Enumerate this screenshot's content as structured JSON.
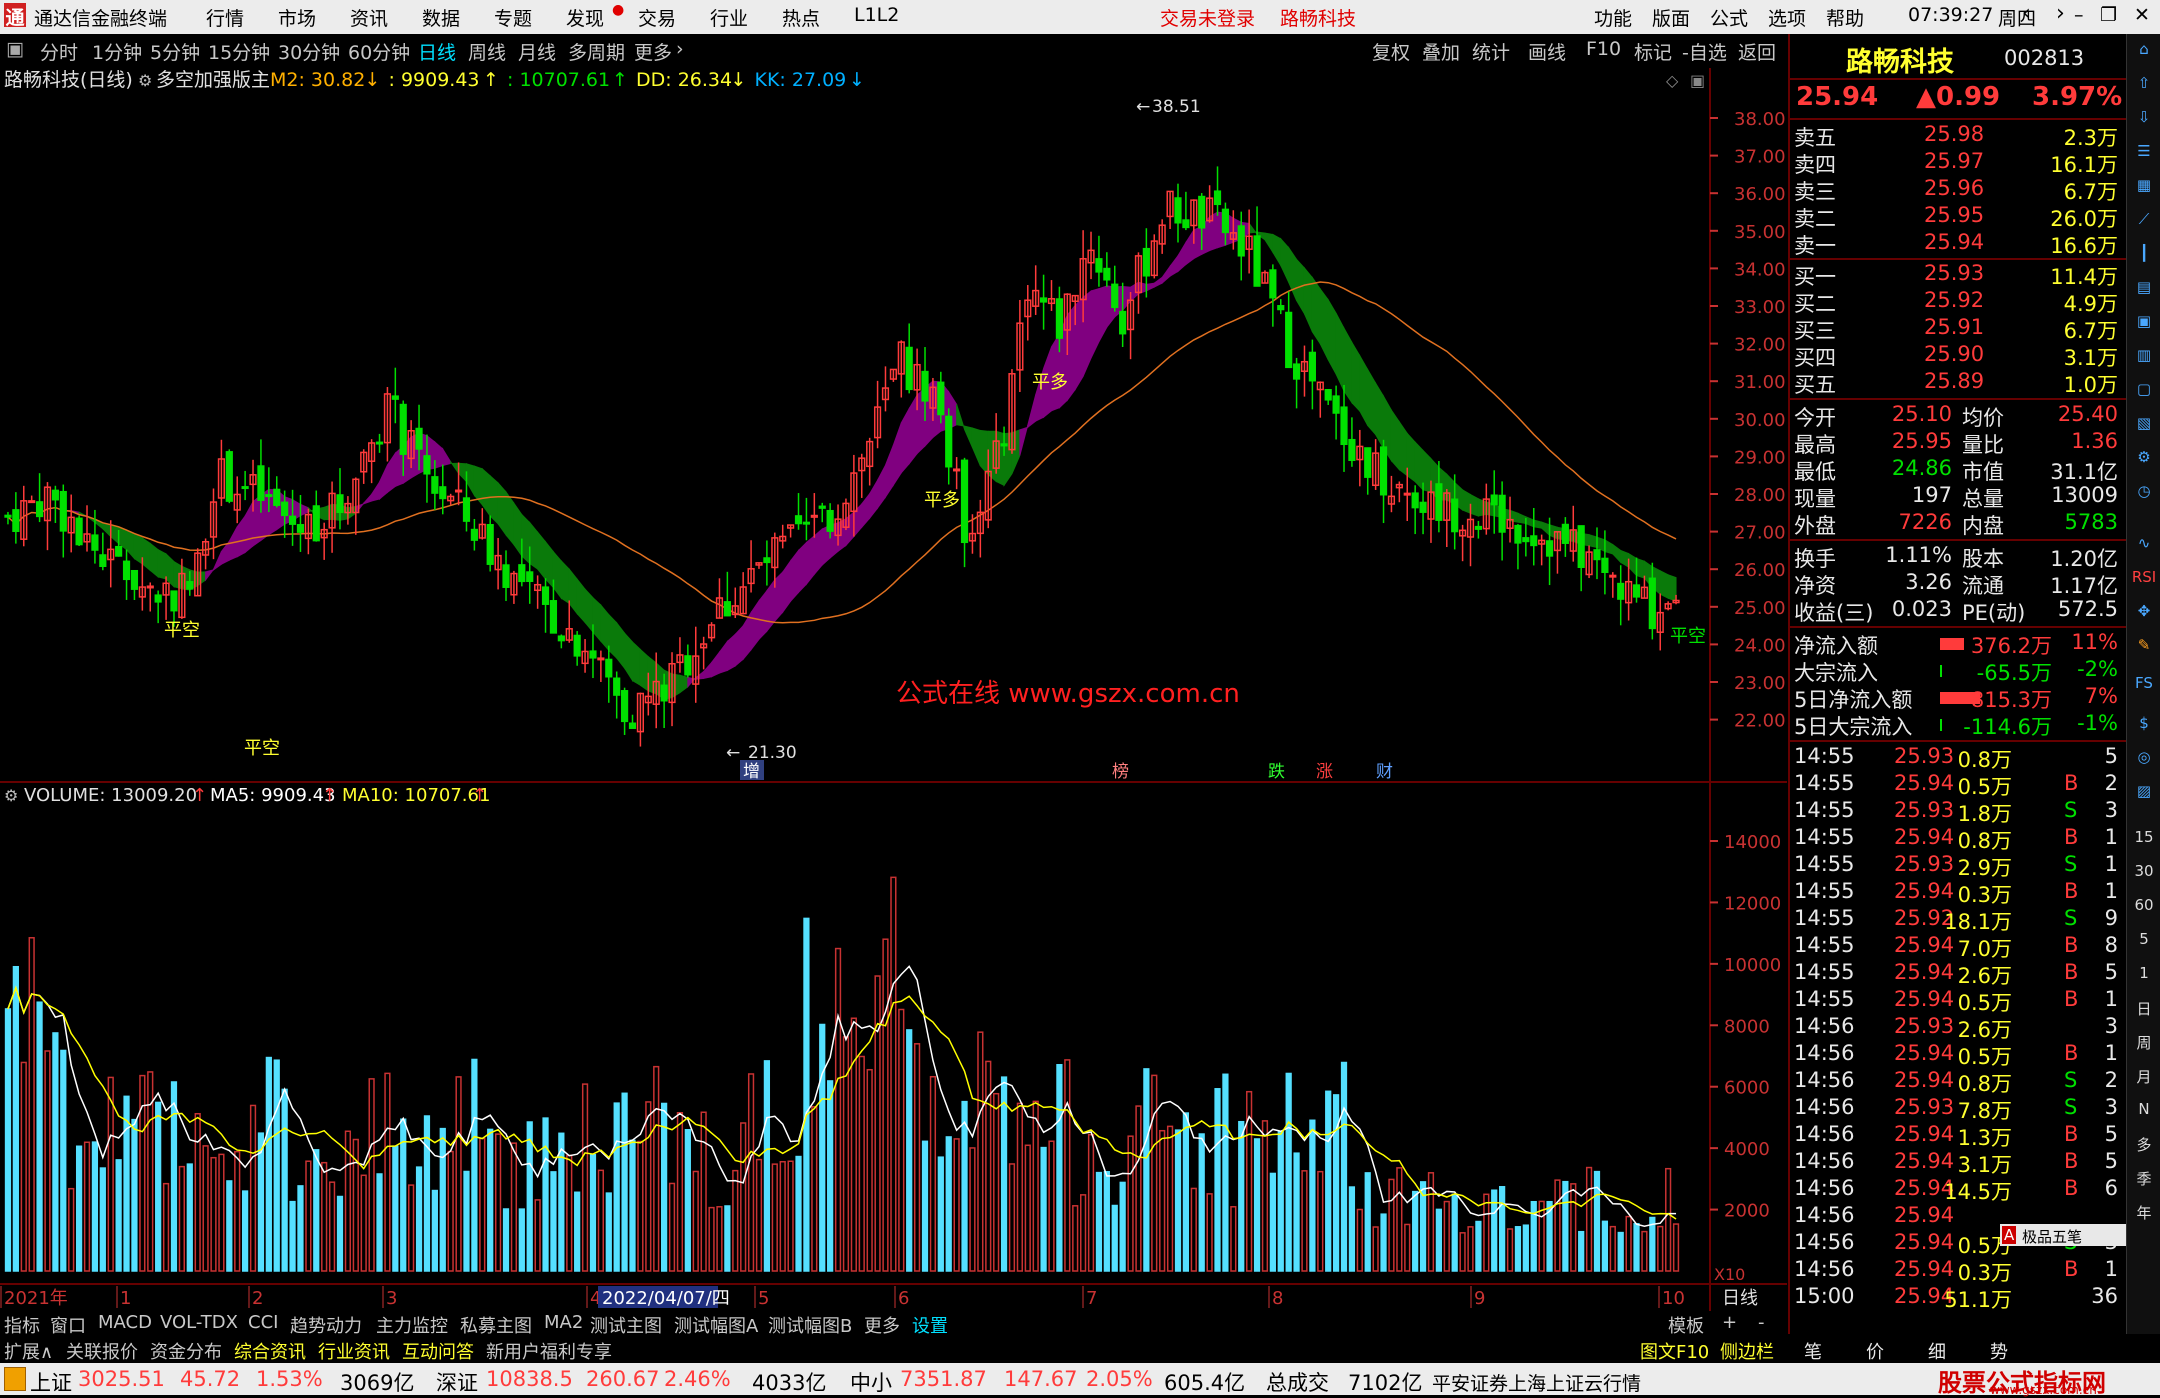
{
  "menubar": {
    "app_title": "通达信金融终端",
    "menus": [
      "行情",
      "市场",
      "资讯",
      "数据",
      "专题",
      "发现",
      "交易",
      "行业",
      "热点",
      "L1L2"
    ],
    "trade_notice": "交易未登录",
    "stock_name": "路畅科技",
    "right_menus": [
      "功能",
      "版面",
      "公式",
      "选项",
      "帮助"
    ],
    "clock": "07:39:27",
    "weekday": "周四"
  },
  "toolbar": {
    "periods": [
      "分时",
      "1分钟",
      "5分钟",
      "15分钟",
      "30分钟",
      "60分钟",
      "日线",
      "周线",
      "月线",
      "多周期",
      "更多"
    ],
    "selected": "日线",
    "right_buttons": [
      "复权",
      "叠加",
      "统计",
      "画线",
      "F10",
      "标记",
      "-自选",
      "返回"
    ]
  },
  "main_chart": {
    "header_title": "路畅科技(日线)",
    "indicator_name": "多空加强版主",
    "indicators": [
      {
        "label": "M2: 30.82",
        "arrow": "↓",
        "color": "#ffb000"
      },
      {
        "label": ": 9909.43",
        "arrow": "↑",
        "color": "#ffff30"
      },
      {
        "label": ": 10707.61",
        "arrow": "↑",
        "color": "#00e000"
      },
      {
        "label": "DD: 26.34",
        "arrow": "↓",
        "color": "#ffff30"
      },
      {
        "label": "KK: 27.09",
        "arrow": "↓",
        "color": "#00b0ff"
      }
    ],
    "price_axis": [
      "38.00",
      "37.00",
      "36.00",
      "35.00",
      "34.00",
      "33.00",
      "32.00",
      "31.00",
      "30.00",
      "29.00",
      "28.00",
      "27.00",
      "26.00",
      "25.00",
      "24.00",
      "23.00",
      "22.00"
    ],
    "high_label": "38.51",
    "low_label": "21.30",
    "signals": [
      {
        "text": "平空",
        "kind": "short"
      },
      {
        "text": "平空",
        "kind": "short"
      },
      {
        "text": "平多",
        "kind": "long"
      },
      {
        "text": "平多",
        "kind": "long"
      },
      {
        "text": "平空",
        "kind": "short"
      }
    ],
    "watermark": "公式在线  www.gszx.com.cn",
    "event_tags": [
      "增",
      "榜",
      "跌",
      "涨",
      "财"
    ]
  },
  "volume_chart": {
    "header": "VOLUME: 13009.20",
    "ma5": "MA5: 9909.43",
    "ma10": "MA10: 10707.61",
    "axis": [
      "14000",
      "12000",
      "10000",
      "8000",
      "6000",
      "4000",
      "2000"
    ],
    "unit": "X10"
  },
  "time_axis": {
    "labels": [
      "2021年",
      "1",
      "2",
      "3",
      "4",
      "5",
      "6",
      "7",
      "8",
      "9",
      "10"
    ],
    "cursor_date": "2022/04/07/四",
    "right_label": "日线"
  },
  "bottom_tabs": [
    "指标",
    "窗口",
    "MACD",
    "VOL-TDX",
    "CCI",
    "趋势动力",
    "主力监控",
    "私募主图",
    "MA2",
    "测试主图",
    "测试幅图A",
    "测试幅图B",
    "更多",
    "设置"
  ],
  "bottom_tabs_right": [
    "模板",
    "+",
    "-"
  ],
  "bottom_tabs2": [
    "扩展∧",
    "关联报价",
    "资金分布",
    "综合资讯",
    "行业资讯",
    "互动问答",
    "新用户福利专享"
  ],
  "bottom_tabs2_right": [
    "图文F10",
    "侧边栏《"
  ],
  "quote": {
    "name": "路畅科技",
    "code": "002813",
    "price": "25.94",
    "change": "▲0.99",
    "pct": "3.97%",
    "asks": [
      {
        "label": "卖五",
        "price": "25.98",
        "vol": "2.3万"
      },
      {
        "label": "卖四",
        "price": "25.97",
        "vol": "16.1万"
      },
      {
        "label": "卖三",
        "price": "25.96",
        "vol": "6.7万"
      },
      {
        "label": "卖二",
        "price": "25.95",
        "vol": "26.0万"
      },
      {
        "label": "卖一",
        "price": "25.94",
        "vol": "16.6万"
      }
    ],
    "bids": [
      {
        "label": "买一",
        "price": "25.93",
        "vol": "11.4万"
      },
      {
        "label": "买二",
        "price": "25.92",
        "vol": "4.9万"
      },
      {
        "label": "买三",
        "price": "25.91",
        "vol": "6.7万"
      },
      {
        "label": "买四",
        "price": "25.90",
        "vol": "3.1万"
      },
      {
        "label": "买五",
        "price": "25.89",
        "vol": "1.0万"
      }
    ],
    "stats": [
      [
        "今开",
        "25.10",
        "均价",
        "25.40"
      ],
      [
        "最高",
        "25.95",
        "量比",
        "1.36"
      ],
      [
        "最低",
        "24.86",
        "市值",
        "31.1亿"
      ],
      [
        "现量",
        "197",
        "总量",
        "13009"
      ],
      [
        "外盘",
        "7226",
        "内盘",
        "5783"
      ]
    ],
    "stats2": [
      [
        "换手",
        "1.11%",
        "股本",
        "1.20亿"
      ],
      [
        "净资",
        "3.26",
        "流通",
        "1.17亿"
      ],
      [
        "收益(三)",
        "0.023",
        "PE(动)",
        "572.5"
      ]
    ],
    "flows": [
      {
        "label": "净流入额",
        "value": "376.2万",
        "pct": "11%"
      },
      {
        "label": "大宗流入",
        "value": "-65.5万",
        "pct": "-2%"
      },
      {
        "label": "5日净流入额",
        "value": "815.3万",
        "pct": "7%"
      },
      {
        "label": "5日大宗流入",
        "value": "-114.6万",
        "pct": "-1%"
      }
    ],
    "ticks": [
      [
        "14:55",
        "25.93",
        "0.8万",
        "",
        "5"
      ],
      [
        "14:55",
        "25.94",
        "0.5万",
        "B",
        "2"
      ],
      [
        "14:55",
        "25.93",
        "1.8万",
        "S",
        "3"
      ],
      [
        "14:55",
        "25.94",
        "0.8万",
        "B",
        "1"
      ],
      [
        "14:55",
        "25.93",
        "2.9万",
        "S",
        "1"
      ],
      [
        "14:55",
        "25.94",
        "0.3万",
        "B",
        "1"
      ],
      [
        "14:55",
        "25.92",
        "18.1万",
        "S",
        "9"
      ],
      [
        "14:55",
        "25.94",
        "7.0万",
        "B",
        "8"
      ],
      [
        "14:55",
        "25.94",
        "2.6万",
        "B",
        "5"
      ],
      [
        "14:55",
        "25.94",
        "0.5万",
        "B",
        "1"
      ],
      [
        "14:56",
        "25.93",
        "2.6万",
        "",
        "3"
      ],
      [
        "14:56",
        "25.94",
        "0.5万",
        "B",
        "1"
      ],
      [
        "14:56",
        "25.94",
        "0.8万",
        "S",
        "2"
      ],
      [
        "14:56",
        "25.93",
        "7.8万",
        "S",
        "3"
      ],
      [
        "14:56",
        "25.94",
        "1.3万",
        "B",
        "5"
      ],
      [
        "14:56",
        "25.94",
        "3.1万",
        "B",
        "5"
      ],
      [
        "14:56",
        "25.94",
        "14.5万",
        "B",
        "6"
      ],
      [
        "14:56",
        "25.94",
        "",
        "",
        ""
      ],
      [
        "14:56",
        "25.94",
        "0.5万",
        "S",
        "3"
      ],
      [
        "14:56",
        "25.94",
        "0.3万",
        "B",
        "1"
      ],
      [
        "15:00",
        "25.94",
        "51.1万",
        "",
        "36"
      ]
    ],
    "tick_tip": "极品五笔",
    "bottom_tabs": [
      "笔",
      "价",
      "细",
      "势"
    ]
  },
  "right_tools": [
    "RSI",
    "FS",
    "日",
    "周",
    "月",
    "N",
    "多",
    "季",
    "年",
    "15",
    "30",
    "60",
    "5",
    "1"
  ],
  "status": {
    "items": [
      {
        "name": "上证",
        "value": "3025.51",
        "chg": "45.72",
        "pct": "1.53%",
        "amt": "3069亿"
      },
      {
        "name": "深证",
        "value": "10838.5",
        "chg": "260.67",
        "pct": "2.46%",
        "amt": "4033亿"
      },
      {
        "name": "中小",
        "value": "7351.87",
        "chg": "147.67",
        "pct": "2.05%",
        "amt": "605.4亿"
      }
    ],
    "total_label": "总成交",
    "total_value": "7102亿",
    "broker": "平安证券上海上证云行情",
    "site_logo": "股票公式指标网",
    "site_url": "www.gszx.com.cn"
  },
  "colors": {
    "up": "#ff3b3b",
    "down": "#00e000",
    "vol_up": "#c83232",
    "vol_down": "#55e0ff",
    "band_up": "#800080",
    "band_down": "#0a7a0a",
    "ma_line": "#e07020",
    "vol_ma5": "#ffffff",
    "vol_ma10": "#ffff00"
  }
}
